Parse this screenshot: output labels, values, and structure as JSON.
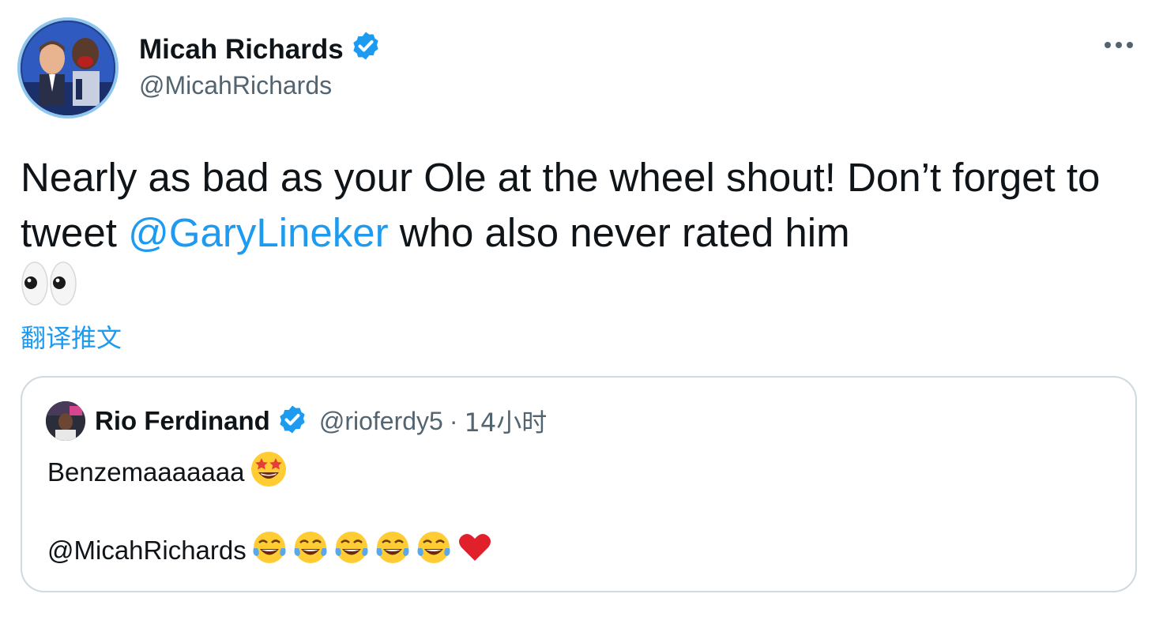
{
  "author": {
    "name": "Micah Richards",
    "handle": "@MicahRichards"
  },
  "tweet": {
    "text_before": "Nearly as bad as your Ole at the wheel shout! Don’t forget to tweet ",
    "mention": "@GaryLineker",
    "text_after": " who also never rated him",
    "emoji": [
      "eyes-emoji"
    ]
  },
  "translate_label": "翻译推文",
  "quoted": {
    "name": "Rio Ferdinand",
    "handle": "@rioferdy5",
    "separator": "·",
    "time": "14小时",
    "line1": "Benzemaaaaaaa",
    "line1_emoji": "star-struck-emoji",
    "line2": "@MicahRichards",
    "line2_emoji": [
      "tears-of-joy-emoji",
      "tears-of-joy-emoji",
      "tears-of-joy-emoji",
      "tears-of-joy-emoji",
      "tears-of-joy-emoji",
      "red-heart-emoji"
    ]
  },
  "colors": {
    "accent": "#1d9bf0",
    "text": "#0f1419",
    "secondary": "#536471",
    "border": "#cfd9de"
  }
}
